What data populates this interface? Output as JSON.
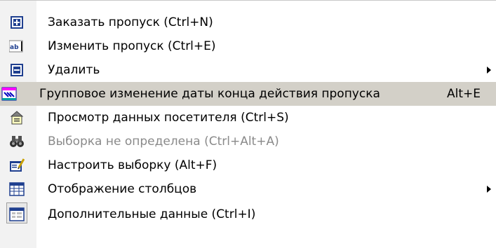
{
  "menu": {
    "items": [
      {
        "label": "Заказать пропуск (Ctrl+N)",
        "icon": "add-icon"
      },
      {
        "label": "Изменить пропуск (Ctrl+E)",
        "icon": "edit-text-icon"
      },
      {
        "label": "Удалить",
        "icon": "delete-icon",
        "has_submenu": true
      },
      {
        "label": "Групповое изменение даты конца действия пропуска",
        "shortcut": "Alt+E",
        "icon": "group-date-change-icon",
        "highlighted": true
      },
      {
        "label": "Просмотр данных посетителя (Ctrl+S)",
        "icon": "visitor-data-icon"
      },
      {
        "label": "Выборка не определена (Ctrl+Alt+A)",
        "icon": "binoculars-icon",
        "disabled": true
      },
      {
        "label": "Настроить выборку (Alt+F)",
        "icon": "configure-filter-icon"
      },
      {
        "label": "Отображение столбцов",
        "icon": "columns-icon",
        "has_submenu": true
      },
      {
        "label": "Дополнительные данные (Ctrl+I)",
        "icon": "additional-data-icon",
        "checked": true
      }
    ]
  },
  "colors": {
    "highlight": "#d3d0c8",
    "disabled_text": "#8a8a8a",
    "icon_blue": "#1f3f8f"
  }
}
